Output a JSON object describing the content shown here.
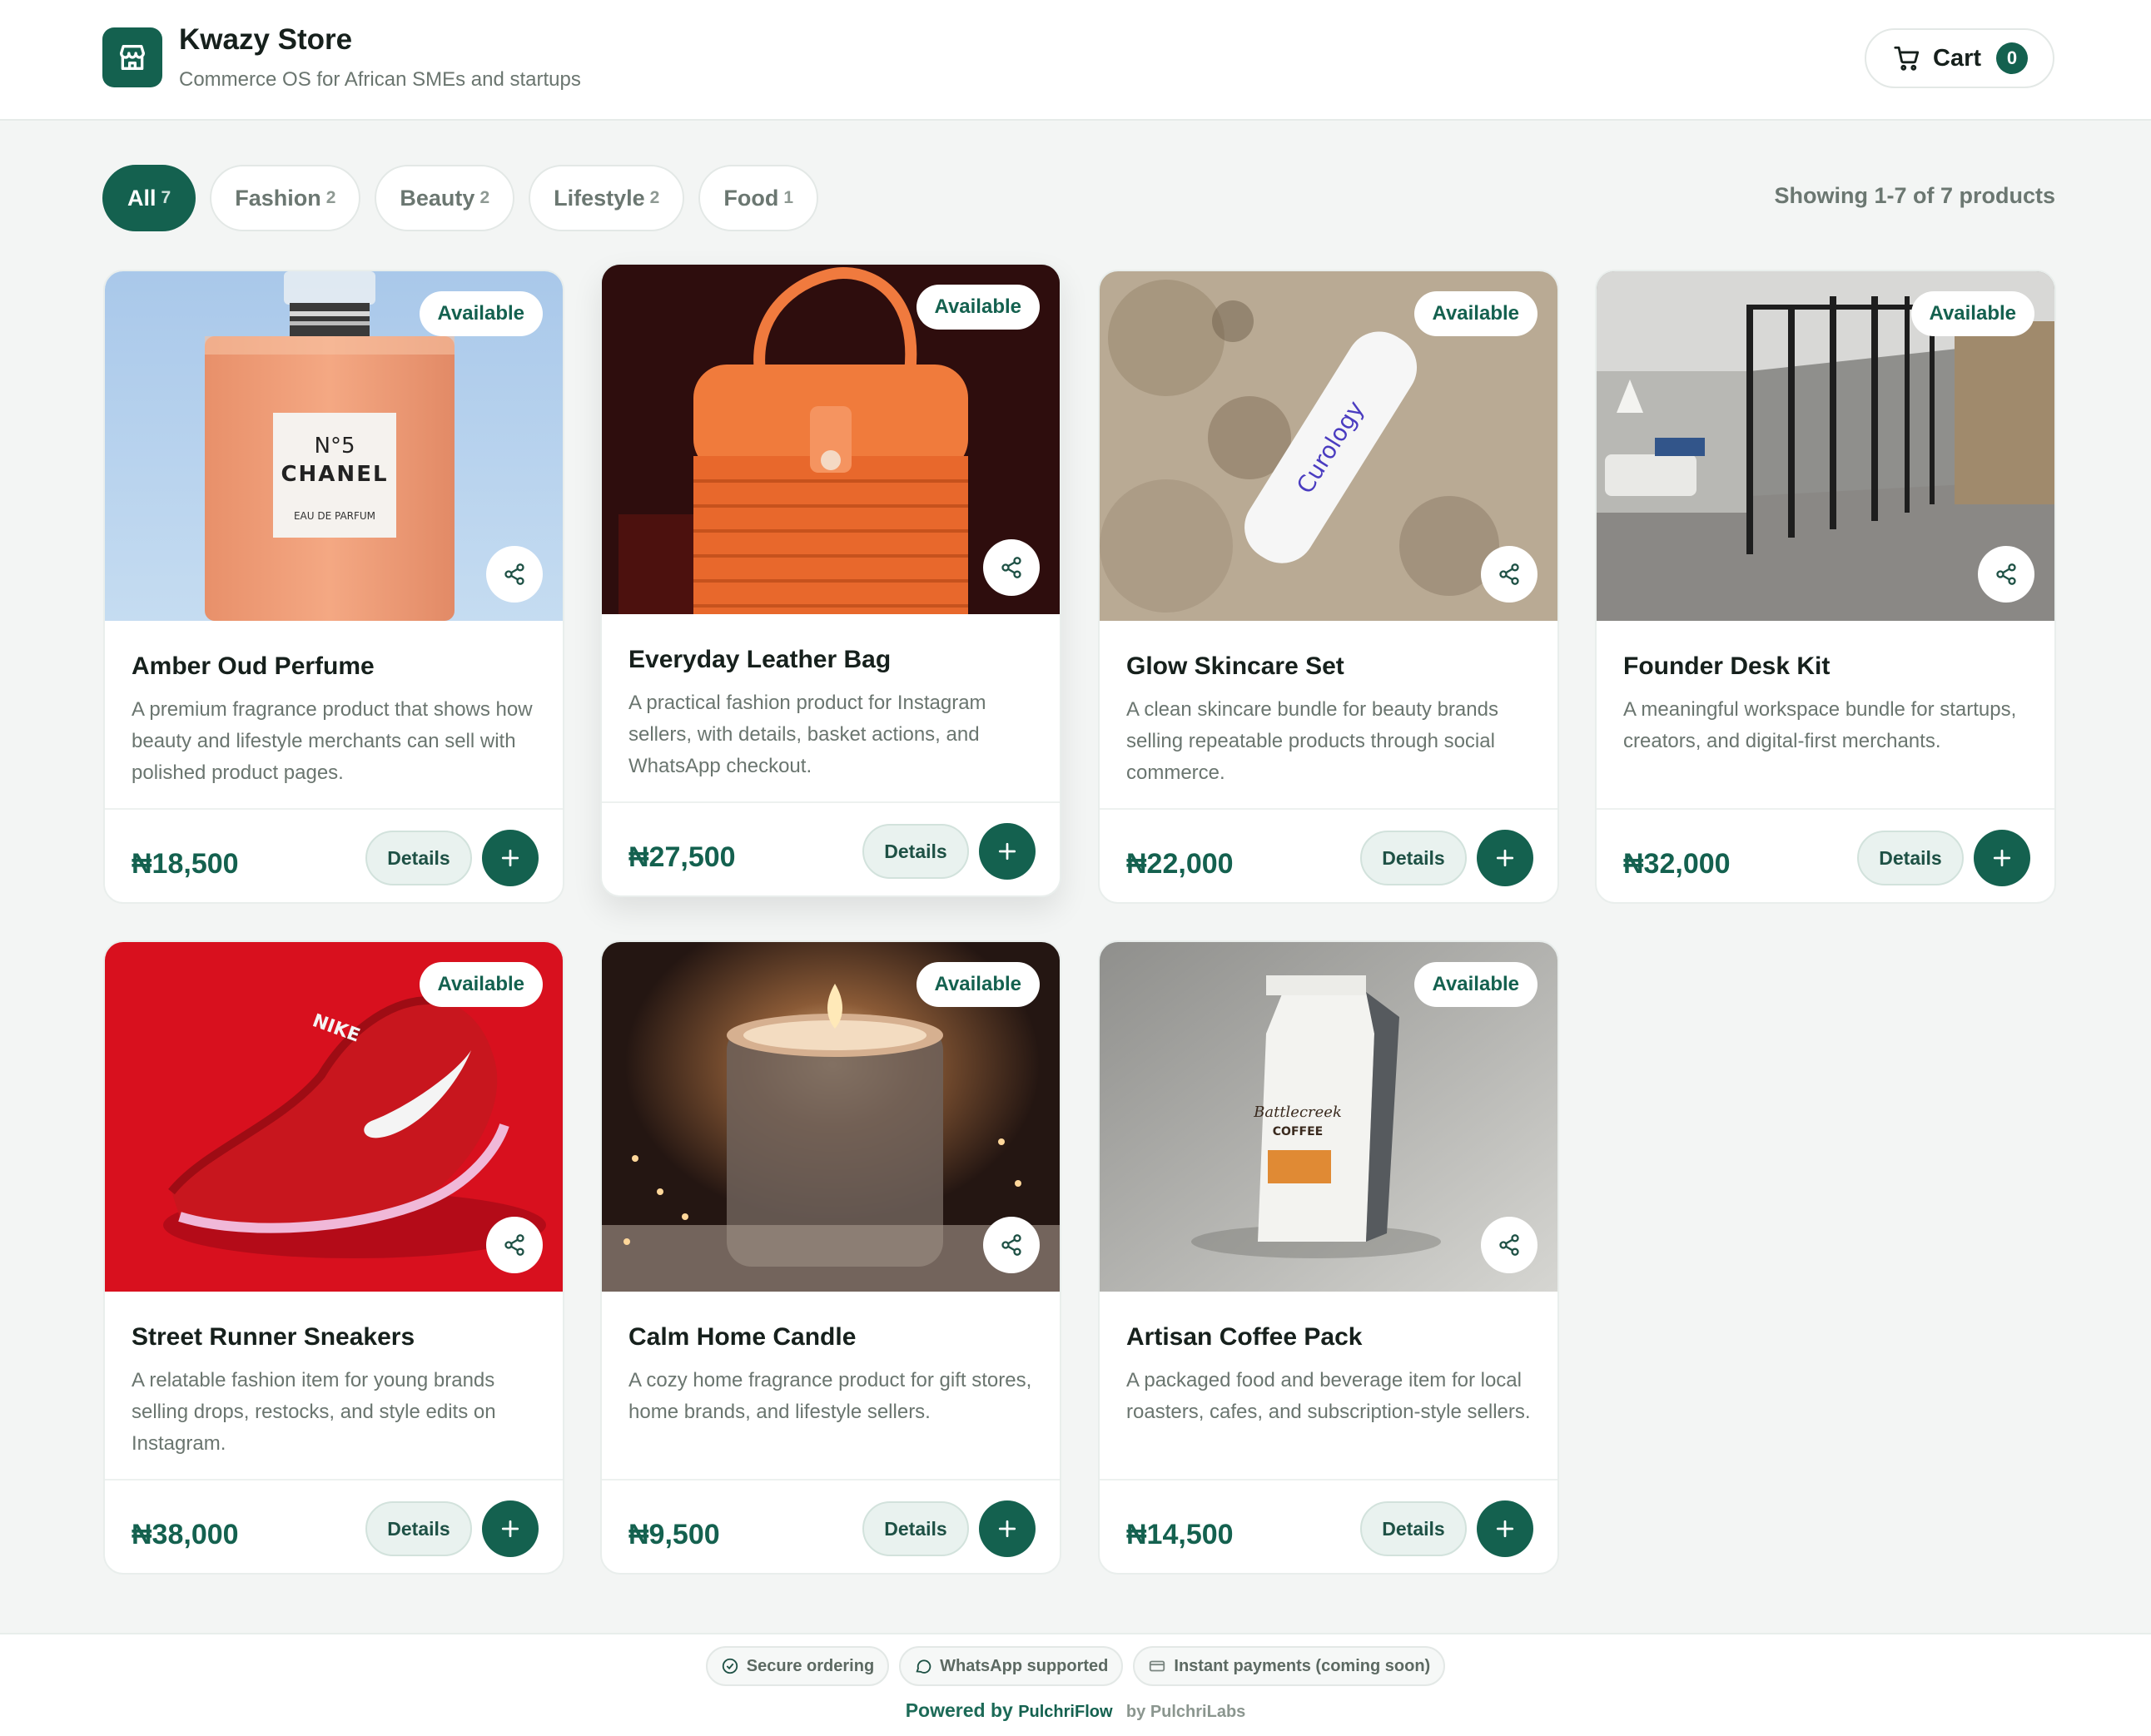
{
  "store": {
    "name": "Kwazy Store",
    "tagline": "Commerce OS for African SMEs and startups",
    "logo_icon": "storefront-icon"
  },
  "cart": {
    "label": "Cart",
    "count": "0",
    "icon": "cart-icon"
  },
  "filters": [
    {
      "label": "All",
      "count": "7",
      "active": true
    },
    {
      "label": "Fashion",
      "count": "2",
      "active": false
    },
    {
      "label": "Beauty",
      "count": "2",
      "active": false
    },
    {
      "label": "Lifestyle",
      "count": "2",
      "active": false
    },
    {
      "label": "Food",
      "count": "1",
      "active": false
    }
  ],
  "showing": "Showing 1-7 of 7 products",
  "products": [
    {
      "name": "Amber Oud Perfume",
      "description": "A premium fragrance product that shows how beauty and lifestyle merchants can sell with polished product pages.",
      "price": "₦18,500",
      "status": "Available",
      "details_label": "Details",
      "image_text": [
        "N°5",
        "CHANEL",
        "EAU DE PARFUM"
      ]
    },
    {
      "name": "Everyday Leather Bag",
      "description": "A practical fashion product for Instagram sellers, with details, basket actions, and WhatsApp checkout.",
      "price": "₦27,500",
      "status": "Available",
      "details_label": "Details"
    },
    {
      "name": "Glow Skincare Set",
      "description": "A clean skincare bundle for beauty brands selling repeatable products through social commerce.",
      "price": "₦22,000",
      "status": "Available",
      "details_label": "Details",
      "image_text": [
        "Curology"
      ]
    },
    {
      "name": "Founder Desk Kit",
      "description": "A meaningful workspace bundle for startups, creators, and digital-first merchants.",
      "price": "₦32,000",
      "status": "Available",
      "details_label": "Details"
    },
    {
      "name": "Street Runner Sneakers",
      "description": "A relatable fashion item for young brands selling drops, restocks, and style edits on Instagram.",
      "price": "₦38,000",
      "status": "Available",
      "details_label": "Details",
      "image_text": [
        "NIKE"
      ]
    },
    {
      "name": "Calm Home Candle",
      "description": "A cozy home fragrance product for gift stores, home brands, and lifestyle sellers.",
      "price": "₦9,500",
      "status": "Available",
      "details_label": "Details"
    },
    {
      "name": "Artisan Coffee Pack",
      "description": "A packaged food and beverage item for local roasters, cafes, and subscription-style sellers.",
      "price": "₦14,500",
      "status": "Available",
      "details_label": "Details",
      "image_text": [
        "Battlecreek",
        "COFFEE"
      ]
    }
  ],
  "footer": {
    "features": [
      {
        "label": "Secure ordering",
        "icon": "check-circle-icon"
      },
      {
        "label": "WhatsApp supported",
        "icon": "chat-bubble-icon"
      },
      {
        "label": "Instant payments (coming soon)",
        "icon": "card-icon"
      }
    ],
    "powered_prefix": "Powered by",
    "powered_brand": "PulchriFlow",
    "powered_by": "by PulchriLabs"
  },
  "colors": {
    "brand": "#14614f",
    "background": "#f3f5f4",
    "muted_text": "#6a756f"
  }
}
